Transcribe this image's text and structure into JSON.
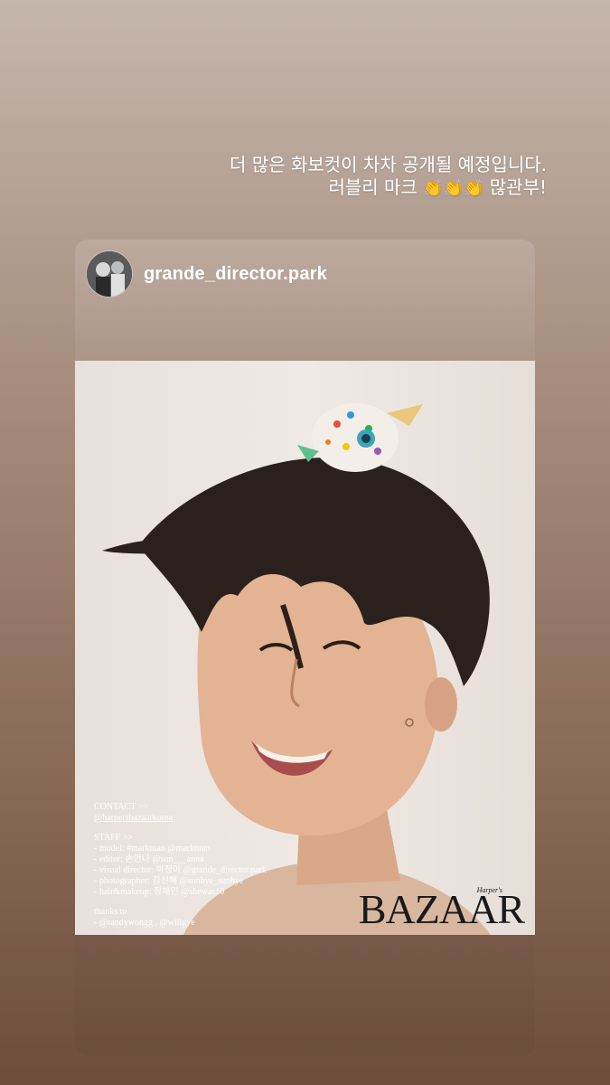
{
  "caption": {
    "line1": "더 많은 화보컷이 차차 공개될 예정입니다.",
    "line2_prefix": "러블리 마크 ",
    "clap_emoji": "👏👏👏",
    "line2_suffix": " 많관부!"
  },
  "post": {
    "username": "grande_director.park",
    "avatar_icon": "profile-avatar",
    "credits": {
      "contact_heading": "CONTACT >>",
      "contact_handle": "@harpersbazaarkorea",
      "staff_heading": "STAFF >>",
      "lines": [
        "- model: #marktuan @marktuan",
        "- editor: 손안나 @son___anna",
        "- visual director: 박정아 @grande_director.park",
        "- photographer: 김선혜 @sunhye_sunhye",
        "- hair&makeup: 장해인 @shewas10"
      ],
      "thanks_heading": "thanks to",
      "thanks_line": "- @randywongg , @willgye"
    },
    "logo_small": "Harper's",
    "logo": "BAZAAR"
  },
  "colors": {
    "background_top": "#c5b6ac",
    "background_bottom": "#6e4d3c",
    "text": "#ffffff"
  }
}
